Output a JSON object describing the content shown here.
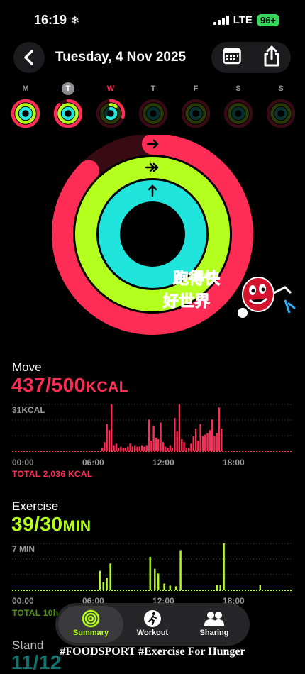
{
  "status_bar": {
    "time": "16:19",
    "weather_icon": "snowflake-icon",
    "network": "LTE",
    "battery": "96+"
  },
  "header": {
    "title": "Tuesday, 4 Nov 2025",
    "back_icon": "chevron-left-icon",
    "calendar_icon": "calendar-icon",
    "share_icon": "share-icon"
  },
  "week": [
    {
      "label": "M",
      "move": 1.0,
      "exercise": 1.0,
      "stand": 1.0
    },
    {
      "label": "T",
      "move": 0.87,
      "exercise": 1.0,
      "stand": 1.0,
      "today": true
    },
    {
      "label": "W",
      "move": 0.3,
      "exercise": 0.1,
      "stand": 0.6
    },
    {
      "label": "T",
      "move": 0,
      "exercise": 0,
      "stand": 0
    },
    {
      "label": "F",
      "move": 0,
      "exercise": 0,
      "stand": 0
    },
    {
      "label": "S",
      "move": 0,
      "exercise": 0,
      "stand": 0
    },
    {
      "label": "S",
      "move": 0,
      "exercise": 0,
      "stand": 0
    }
  ],
  "rings": {
    "move": 0.874,
    "exercise": 1.3,
    "stand": 1.17
  },
  "colors": {
    "move": "#ff2d55",
    "exercise": "#b5ff1f",
    "stand": "#1fe5dc"
  },
  "watermark": {
    "text_line1": "跑得快",
    "text_line2": "好世界"
  },
  "move": {
    "title": "Move",
    "value": "437/500",
    "unit": "KCAL",
    "y_max_label": "31KCAL",
    "total": "TOTAL 2,036 KCAL"
  },
  "exercise": {
    "title": "Exercise",
    "value": "39/30",
    "unit": "MIN",
    "y_max_label": "7 MIN",
    "total": "TOTAL 10h 30 MIN"
  },
  "stand": {
    "title": "Stand",
    "value": "11/12"
  },
  "x_ticks": [
    "00:00",
    "06:00",
    "12:00",
    "18:00"
  ],
  "chart_data": [
    {
      "type": "bar",
      "title": "Move",
      "ylabel": "KCAL",
      "ylim": [
        0,
        31
      ],
      "x": [
        7.7,
        7.9,
        8.1,
        8.3,
        8.5,
        8.7,
        8.9,
        9.1,
        9.3,
        9.5,
        9.7,
        9.9,
        10.1,
        10.3,
        10.5,
        10.7,
        10.9,
        11.1,
        11.3,
        11.5,
        11.7,
        11.9,
        12.1,
        12.3,
        12.5,
        12.7,
        12.9,
        13.1,
        13.3,
        13.5,
        13.7,
        13.9,
        14.1,
        14.3,
        14.5,
        14.7,
        14.9,
        15.1,
        15.3,
        15.5,
        15.7,
        15.9,
        16.1,
        16.3,
        16.5,
        16.7,
        16.9,
        17.1,
        17.3,
        17.5,
        17.7,
        17.9
      ],
      "values": [
        2,
        6,
        18,
        14,
        31,
        4,
        5,
        2,
        3,
        2,
        2,
        3,
        5,
        3,
        4,
        3,
        3,
        4,
        3,
        4,
        21,
        7,
        17,
        9,
        8,
        19,
        6,
        3,
        2,
        4,
        2,
        22,
        13,
        31,
        8,
        6,
        2,
        2,
        5,
        10,
        15,
        7,
        18,
        10,
        11,
        12,
        14,
        21,
        10,
        12,
        29,
        15
      ],
      "xlim": [
        0,
        24
      ]
    },
    {
      "type": "bar",
      "title": "Exercise",
      "ylabel": "MIN",
      "ylim": [
        0,
        7
      ],
      "x": [
        7.5,
        7.8,
        8.1,
        8.4,
        11.8,
        12.2,
        12.5,
        13.0,
        13.5,
        14.0,
        14.4,
        17.5,
        17.8,
        18.1,
        21.2
      ],
      "values": [
        2.9,
        1.2,
        1.9,
        4.0,
        5.0,
        3.2,
        2.5,
        1.0,
        0.7,
        0.6,
        6.0,
        0.8,
        0.8,
        7.0,
        0.8
      ],
      "xlim": [
        0,
        24
      ]
    }
  ],
  "tabs": [
    {
      "label": "Summary",
      "icon": "activity-rings-icon",
      "active": true
    },
    {
      "label": "Workout",
      "icon": "running-figure-icon"
    },
    {
      "label": "Sharing",
      "icon": "people-icon"
    }
  ],
  "footer_text": "#FOODSPORT #Exercise For Hunger"
}
